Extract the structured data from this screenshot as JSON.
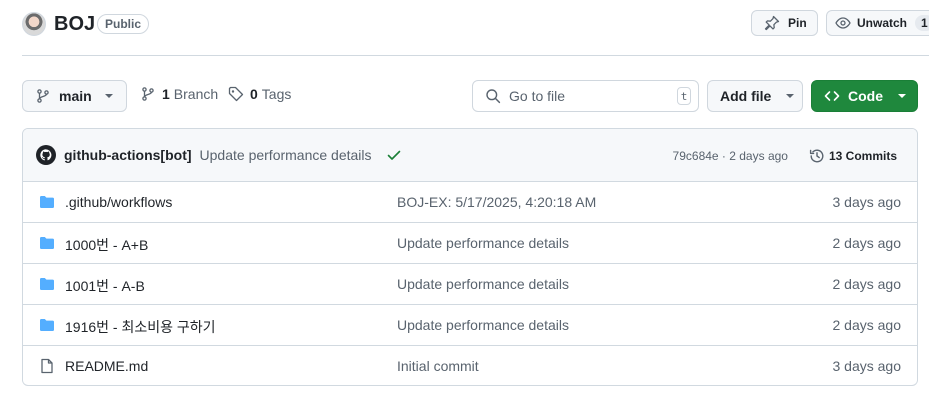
{
  "repo": {
    "name": "BOJ",
    "visibility": "Public"
  },
  "header_actions": {
    "pin_label": "Pin",
    "watch_label": "Unwatch",
    "watch_count": "1"
  },
  "toolbar": {
    "branch": "main",
    "branches_count": "1",
    "branches_label": "Branch",
    "tags_count": "0",
    "tags_label": "Tags",
    "search_placeholder": "Go to file",
    "search_shortcut": "t",
    "add_file_label": "Add file",
    "code_label": "Code"
  },
  "latest_commit": {
    "author": "github-actions[bot]",
    "message": "Update performance details",
    "sha_date": "79c684e · 2 days ago",
    "commits_label": "13 Commits"
  },
  "files": [
    {
      "name": ".github/workflows",
      "type": "folder",
      "message": "BOJ-EX: 5/17/2025, 4:20:18 AM",
      "date": "3 days ago"
    },
    {
      "name": "1000번 - A+B",
      "type": "folder",
      "message": "Update performance details",
      "date": "2 days ago"
    },
    {
      "name": "1001번 - A-B",
      "type": "folder",
      "message": "Update performance details",
      "date": "2 days ago"
    },
    {
      "name": "1916번 - 최소비용 구하기",
      "type": "folder",
      "message": "Update performance details",
      "date": "2 days ago"
    },
    {
      "name": "README.md",
      "type": "file",
      "message": "Initial commit",
      "date": "3 days ago"
    }
  ],
  "colors": {
    "folder": "#54aeff",
    "primary": "#1f883d",
    "success": "#1a7f37"
  }
}
